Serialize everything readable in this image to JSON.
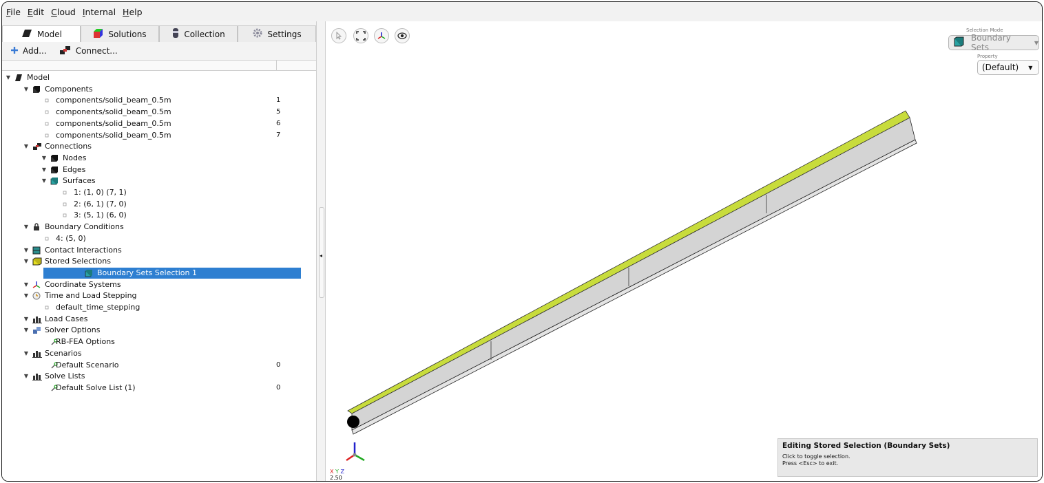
{
  "menu": {
    "items": [
      {
        "first": "F",
        "rest": "ile"
      },
      {
        "first": "E",
        "rest": "dit"
      },
      {
        "first": "C",
        "rest": "loud"
      },
      {
        "first": "I",
        "rest": "nternal"
      },
      {
        "first": "H",
        "rest": "elp"
      }
    ]
  },
  "tabs": [
    {
      "label": "Model",
      "icon": "model-icon",
      "active": true
    },
    {
      "label": "Solutions",
      "icon": "solutions-icon",
      "active": false
    },
    {
      "label": "Collection",
      "icon": "collection-icon",
      "active": false
    },
    {
      "label": "Settings",
      "icon": "settings-icon",
      "active": false
    }
  ],
  "toolbar": {
    "add_label": "Add...",
    "connect_label": "Connect..."
  },
  "tree": [
    {
      "label": "Model",
      "level": 0,
      "arrow": true,
      "icon": "model",
      "num": ""
    },
    {
      "label": "Components",
      "level": 1,
      "arrow": true,
      "icon": "box",
      "num": ""
    },
    {
      "label": "components/solid_beam_0.5m",
      "level": 2,
      "arrow": false,
      "icon": "leaf",
      "num": "1"
    },
    {
      "label": "components/solid_beam_0.5m",
      "level": 2,
      "arrow": false,
      "icon": "leaf",
      "num": "5"
    },
    {
      "label": "components/solid_beam_0.5m",
      "level": 2,
      "arrow": false,
      "icon": "leaf",
      "num": "6"
    },
    {
      "label": "components/solid_beam_0.5m",
      "level": 2,
      "arrow": false,
      "icon": "leaf",
      "num": "7"
    },
    {
      "label": "Connections",
      "level": 1,
      "arrow": true,
      "icon": "connect",
      "num": ""
    },
    {
      "label": "Nodes",
      "level": 2,
      "arrow": true,
      "icon": "box",
      "num": ""
    },
    {
      "label": "Edges",
      "level": 2,
      "arrow": true,
      "icon": "box",
      "num": ""
    },
    {
      "label": "Surfaces",
      "level": 2,
      "arrow": true,
      "icon": "boxteal",
      "num": ""
    },
    {
      "label": "1: (1, 0) (7, 1)",
      "level": 3,
      "arrow": false,
      "icon": "leaf",
      "num": ""
    },
    {
      "label": "2: (6, 1) (7, 0)",
      "level": 3,
      "arrow": false,
      "icon": "leaf",
      "num": ""
    },
    {
      "label": "3: (5, 1) (6, 0)",
      "level": 3,
      "arrow": false,
      "icon": "leaf",
      "num": ""
    },
    {
      "label": "Boundary Conditions",
      "level": 1,
      "arrow": true,
      "icon": "lock",
      "num": ""
    },
    {
      "label": "4: (5, 0)",
      "level": 2,
      "arrow": false,
      "icon": "leaf",
      "num": ""
    },
    {
      "label": "Contact Interactions",
      "level": 1,
      "arrow": true,
      "icon": "contact",
      "num": ""
    },
    {
      "label": "Stored Selections",
      "level": 1,
      "arrow": true,
      "icon": "stored",
      "num": ""
    },
    {
      "label": "Boundary Sets Selection 1",
      "level": 2,
      "arrow": false,
      "icon": "boxteal",
      "num": "",
      "selected": true
    },
    {
      "label": "Coordinate Systems",
      "level": 1,
      "arrow": true,
      "icon": "axes",
      "num": ""
    },
    {
      "label": "Time and Load Stepping",
      "level": 1,
      "arrow": true,
      "icon": "clock",
      "num": ""
    },
    {
      "label": "default_time_stepping",
      "level": 2,
      "arrow": false,
      "icon": "leaf",
      "num": ""
    },
    {
      "label": "Load Cases",
      "level": 1,
      "arrow": true,
      "icon": "bars",
      "num": ""
    },
    {
      "label": "Solver Options",
      "level": 1,
      "arrow": true,
      "icon": "solver",
      "num": ""
    },
    {
      "label": "RB-FEA Options",
      "level": 2,
      "arrow": false,
      "icon": "wrench",
      "num": ""
    },
    {
      "label": "Scenarios",
      "level": 1,
      "arrow": true,
      "icon": "bars",
      "num": ""
    },
    {
      "label": "Default Scenario",
      "level": 2,
      "arrow": false,
      "icon": "wrench",
      "num": "0"
    },
    {
      "label": "Solve Lists",
      "level": 1,
      "arrow": true,
      "icon": "bars",
      "num": ""
    },
    {
      "label": "Default Solve List (1)",
      "level": 2,
      "arrow": false,
      "icon": "wrench",
      "num": "0"
    }
  ],
  "viewport": {
    "selection_mode_label": "Selection Mode",
    "selection_mode_value": "Boundary Sets",
    "property_label": "Property",
    "property_value": "(Default)",
    "info_title": "Editing Stored Selection (Boundary Sets)",
    "info_line1": "Click to toggle selection.",
    "info_line2": "Press <Esc> to exit.",
    "axis_x": "X",
    "axis_y": "Y",
    "axis_z": "Z",
    "scale_value": "2.50"
  },
  "colors": {
    "selection_highlight": "#2e7fd1",
    "beam_top": "#c8dc3c",
    "beam_side": "#d4d4d4",
    "axis_x": "#d22",
    "axis_y": "#2a2",
    "axis_z": "#22c"
  }
}
